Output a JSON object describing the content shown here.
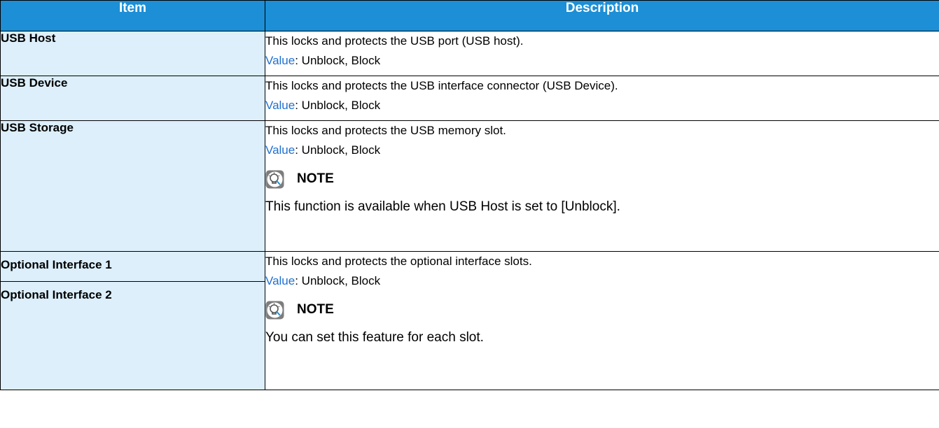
{
  "headers": {
    "item": "Item",
    "description": "Description"
  },
  "rows": [
    {
      "item": "USB Host",
      "description": "This locks and protects the USB port (USB host).",
      "value_label": "Value",
      "value_text": ": Unblock, Block"
    },
    {
      "item": "USB Device",
      "description": "This locks and protects the USB interface connector (USB Device).",
      "value_label": "Value",
      "value_text": ": Unblock, Block"
    },
    {
      "item": "USB Storage",
      "description": "This locks and protects the USB memory slot.",
      "value_label": "Value",
      "value_text": ": Unblock, Block",
      "note_label": "NOTE",
      "note_text": "This function is available when USB Host is set to [Unblock]."
    },
    {
      "items": [
        "Optional Interface 1",
        "Optional Interface 2"
      ],
      "description": "This locks and protects the optional interface slots.",
      "value_label": "Value",
      "value_text": ": Unblock, Block",
      "note_label": "NOTE",
      "note_text": "You can set this feature for each slot."
    }
  ],
  "colors": {
    "header_bg": "#1c8fd6",
    "item_bg": "#dceffa",
    "value_label": "#2070d0"
  },
  "icons": {
    "note": "note-lightbulb-icon"
  }
}
